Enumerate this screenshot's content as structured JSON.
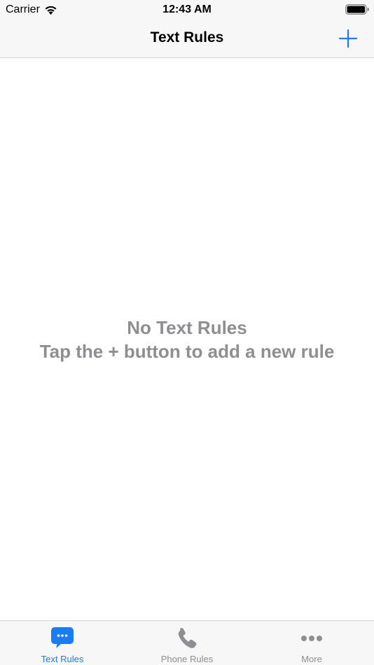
{
  "status_bar": {
    "carrier": "Carrier",
    "time": "12:43 AM",
    "wifi_icon": "wifi-icon",
    "battery_icon": "battery-icon"
  },
  "nav": {
    "title": "Text Rules",
    "add_icon": "plus-icon",
    "accent_color": "#1a7cf2"
  },
  "empty_state": {
    "title": "No Text Rules",
    "hint": "Tap the + button to add a new rule",
    "color": "#8e8e93"
  },
  "tab_bar": {
    "tabs": [
      {
        "label": "Text Rules",
        "icon": "message-bubble-icon",
        "active": true
      },
      {
        "label": "Phone Rules",
        "icon": "phone-icon",
        "active": false
      },
      {
        "label": "More",
        "icon": "more-icon",
        "active": false
      }
    ],
    "active_color": "#1a7cf2",
    "inactive_color": "#8e8e93"
  }
}
